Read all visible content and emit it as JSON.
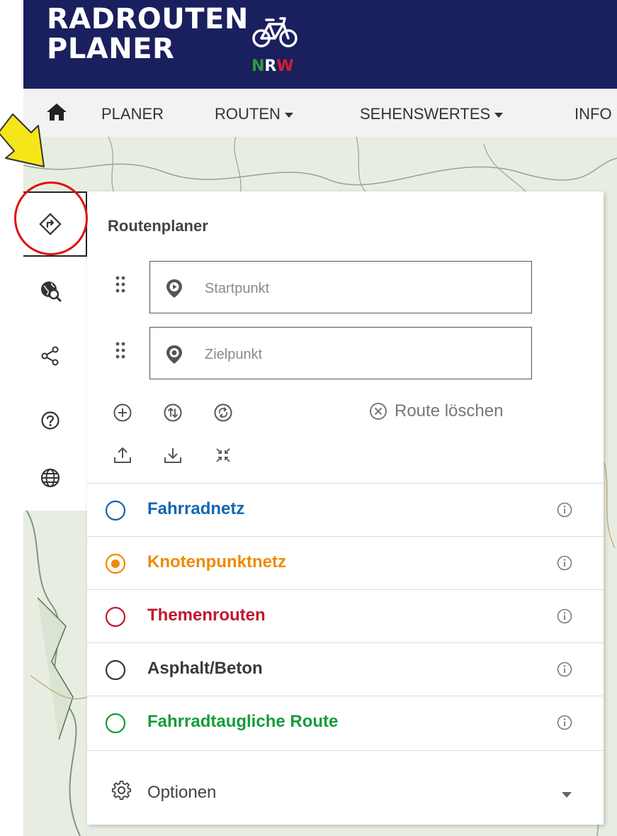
{
  "header": {
    "logo_line1": "RADROUTEN",
    "logo_line2": "PLANER",
    "logo_nrw": [
      "N",
      "R",
      "W"
    ],
    "logo_nrw_colors": [
      "#2e9b3a",
      "#ffffff",
      "#d1202a"
    ],
    "background": "#1a1f5e"
  },
  "nav": {
    "home_icon": "home-icon",
    "items": [
      {
        "label": "PLANER",
        "dropdown": false
      },
      {
        "label": "ROUTEN",
        "dropdown": true
      },
      {
        "label": "SEHENSWERTES",
        "dropdown": true
      },
      {
        "label": "INFO",
        "dropdown": false
      }
    ]
  },
  "toolbar": {
    "items": [
      {
        "icon": "route-directions-icon",
        "active": true
      },
      {
        "icon": "globe-search-icon",
        "active": false
      },
      {
        "icon": "share-icon",
        "active": false
      },
      {
        "icon": "help-icon",
        "active": false
      },
      {
        "icon": "language-globe-icon",
        "active": false
      }
    ]
  },
  "panel": {
    "title": "Routenplaner",
    "start": {
      "placeholder": "Startpunkt",
      "value": ""
    },
    "end": {
      "placeholder": "Zielpunkt",
      "value": ""
    },
    "actions_row1": [
      "add-waypoint-icon",
      "swap-icon",
      "reverse-route-icon"
    ],
    "actions_row2": [
      "upload-icon",
      "download-icon",
      "collapse-icon"
    ],
    "route_delete_label": "Route löschen",
    "networks": [
      {
        "label": "Fahrradnetz",
        "color": "#1565b3",
        "selected": false
      },
      {
        "label": "Knotenpunktnetz",
        "color": "#ef8a00",
        "selected": true
      },
      {
        "label": "Themenrouten",
        "color": "#c0182e",
        "selected": false
      },
      {
        "label": "Asphalt/Beton",
        "color": "#3a3a3a",
        "selected": false
      },
      {
        "label": "Fahrradtaugliche Route",
        "color": "#169b3c",
        "selected": false
      }
    ],
    "options_label": "Optionen"
  },
  "annotation": {
    "arrow_color": "#f5e61a",
    "circle_color": "#e01010"
  }
}
